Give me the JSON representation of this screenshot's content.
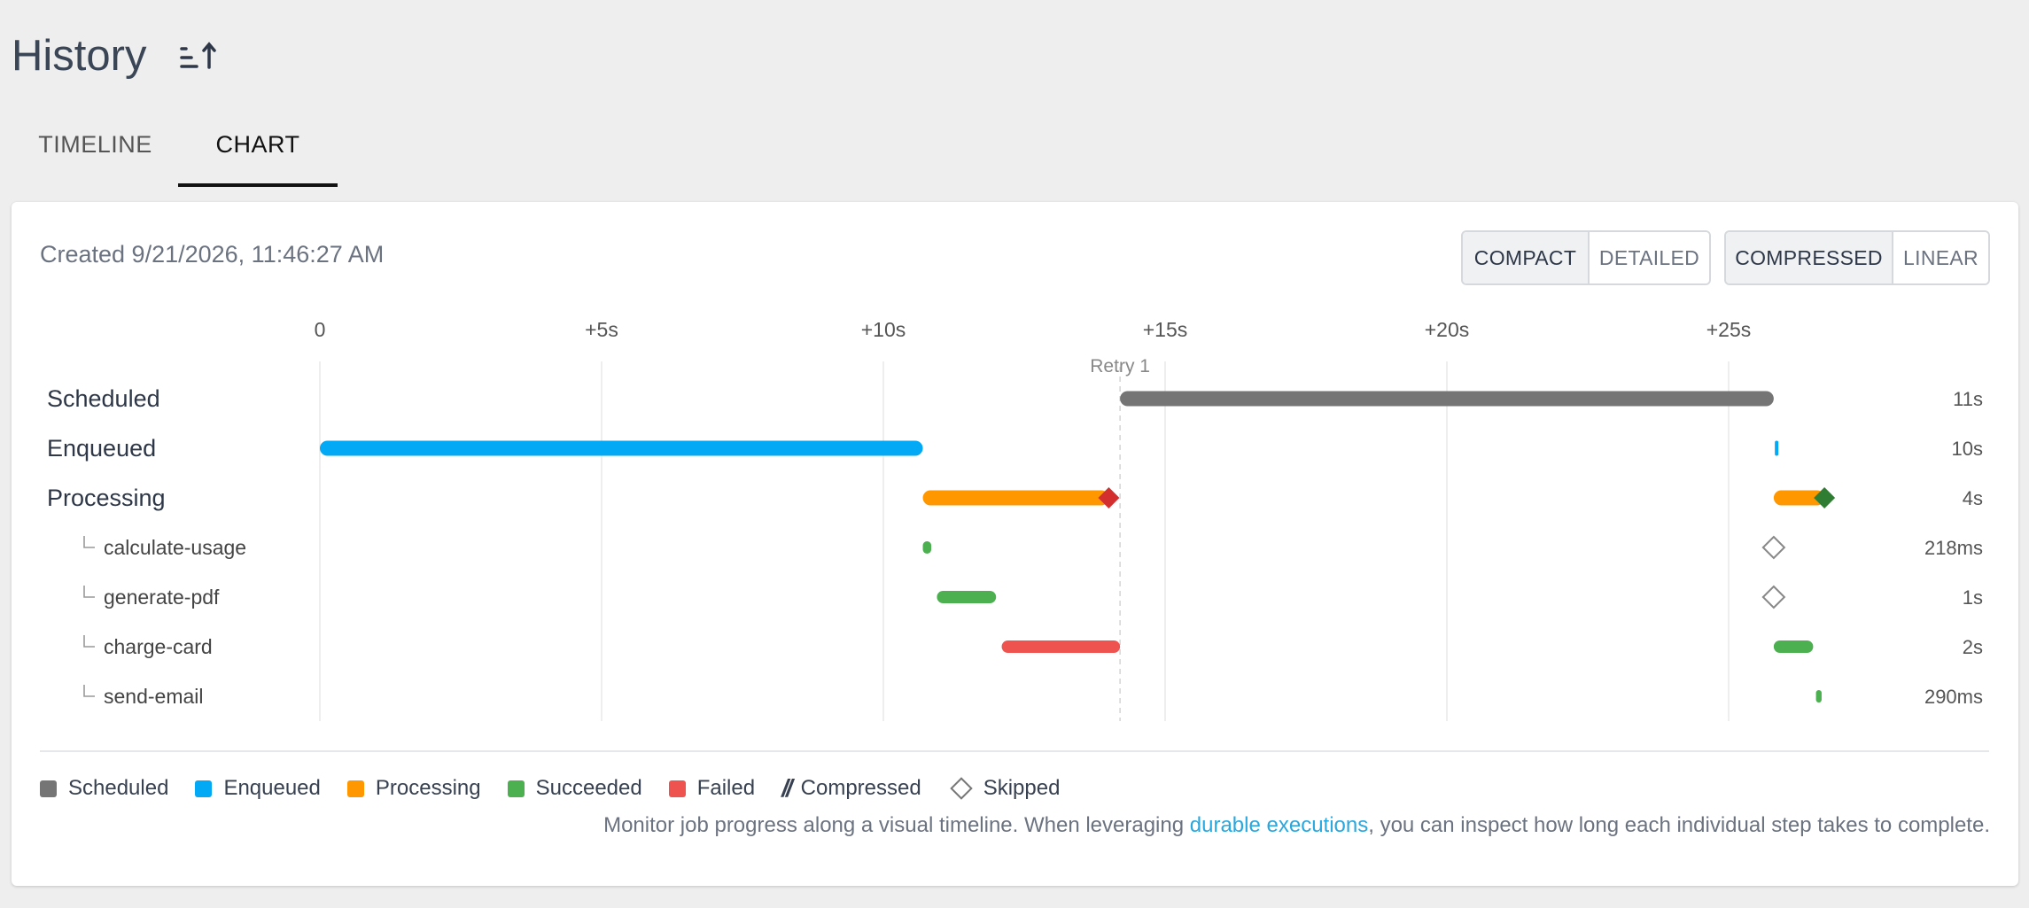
{
  "header": {
    "title": "History",
    "sort_icon": "sort-ascending-icon"
  },
  "tabs": [
    {
      "label": "TIMELINE",
      "active": false
    },
    {
      "label": "CHART",
      "active": true
    }
  ],
  "card": {
    "created_label": "Created 9/21/2026, 11:46:27 AM",
    "view_toggle": {
      "options": [
        "COMPACT",
        "DETAILED"
      ],
      "selected": "COMPACT"
    },
    "scale_toggle": {
      "options": [
        "COMPRESSED",
        "LINEAR"
      ],
      "selected": "COMPRESSED"
    }
  },
  "chart_data": {
    "type": "gantt",
    "x_ticks": [
      "0",
      "+5s",
      "+10s",
      "+15s",
      "+20s",
      "+25s"
    ],
    "x_tick_values_s": [
      0,
      5,
      10,
      15,
      20,
      25
    ],
    "markers": [
      {
        "label": "Retry 1",
        "at_s": 14.2
      }
    ],
    "rows": [
      {
        "label": "Scheduled",
        "level": 0,
        "duration": "11s",
        "spans": [
          {
            "start_s": 14.2,
            "end_s": 25.8,
            "status": "scheduled"
          }
        ]
      },
      {
        "label": "Enqueued",
        "level": 0,
        "duration": "10s",
        "spans": [
          {
            "start_s": 0,
            "end_s": 10.7,
            "status": "enqueued"
          },
          {
            "start_s": 25.82,
            "end_s": 25.85,
            "status": "enqueued"
          }
        ]
      },
      {
        "label": "Processing",
        "level": 0,
        "duration": "4s",
        "spans": [
          {
            "start_s": 10.7,
            "end_s": 14.0,
            "status": "processing",
            "end_marker": "failed"
          },
          {
            "start_s": 25.8,
            "end_s": 26.7,
            "status": "processing",
            "end_marker": "succeeded"
          }
        ]
      },
      {
        "label": "calculate-usage",
        "level": 1,
        "duration": "218ms",
        "spans": [
          {
            "start_s": 10.7,
            "end_s": 10.85,
            "status": "succeeded"
          },
          {
            "at_s": 25.8,
            "status": "skipped"
          }
        ]
      },
      {
        "label": "generate-pdf",
        "level": 1,
        "duration": "1s",
        "spans": [
          {
            "start_s": 10.95,
            "end_s": 12.0,
            "status": "succeeded"
          },
          {
            "at_s": 25.8,
            "status": "skipped"
          }
        ]
      },
      {
        "label": "charge-card",
        "level": 1,
        "duration": "2s",
        "spans": [
          {
            "start_s": 12.1,
            "end_s": 14.2,
            "status": "failed"
          },
          {
            "start_s": 25.8,
            "end_s": 26.5,
            "status": "succeeded"
          }
        ]
      },
      {
        "label": "send-email",
        "level": 1,
        "duration": "290ms",
        "spans": [
          {
            "start_s": 26.55,
            "end_s": 26.65,
            "status": "succeeded"
          }
        ]
      }
    ],
    "status_colors": {
      "scheduled": "#757575",
      "enqueued": "#03a9f4",
      "processing": "#ff9800",
      "succeeded": "#4caf50",
      "failed": "#ef5350",
      "failed_marker": "#d32f2f",
      "succeeded_marker": "#2e7d32",
      "skipped": "#888888"
    }
  },
  "legend": [
    {
      "label": "Scheduled",
      "color": "#757575",
      "kind": "swatch"
    },
    {
      "label": "Enqueued",
      "color": "#03a9f4",
      "kind": "swatch"
    },
    {
      "label": "Processing",
      "color": "#ff9800",
      "kind": "swatch"
    },
    {
      "label": "Succeeded",
      "color": "#4caf50",
      "kind": "swatch"
    },
    {
      "label": "Failed",
      "color": "#ef5350",
      "kind": "swatch"
    },
    {
      "label": "Compressed",
      "kind": "compressed",
      "glyph": "//"
    },
    {
      "label": "Skipped",
      "kind": "skipped"
    }
  ],
  "footer": {
    "text_before": "Monitor job progress along a visual timeline. When leveraging ",
    "link_text": "durable executions",
    "text_after": ", you can inspect how long each individual step takes to complete."
  }
}
